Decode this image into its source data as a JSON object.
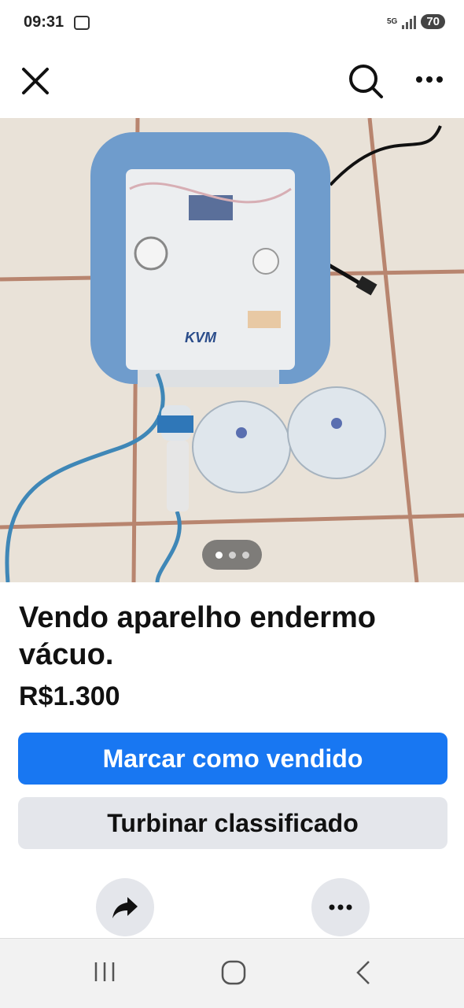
{
  "status_bar": {
    "time": "09:31",
    "network": "5G",
    "battery": "70"
  },
  "top_bar": {
    "close_icon": "close-icon",
    "search_icon": "search-icon",
    "more_icon": "more-horizontal-icon"
  },
  "photo": {
    "description_icon": "product-photo",
    "carousel_total": 3,
    "carousel_active": 1
  },
  "listing": {
    "title": "Vendo aparelho endermo vácuo.",
    "price": "R$1.300"
  },
  "actions": {
    "mark_sold": "Marcar como vendido",
    "boost": "Turbinar classificado",
    "share_icon": "share-arrow-icon",
    "more_icon": "more-horizontal-icon"
  },
  "colors": {
    "primary": "#1877f2",
    "secondary_bg": "#e4e6eb"
  },
  "nav_bar": {
    "recents_icon": "recents-icon",
    "home_icon": "home-icon",
    "back_icon": "back-icon"
  }
}
